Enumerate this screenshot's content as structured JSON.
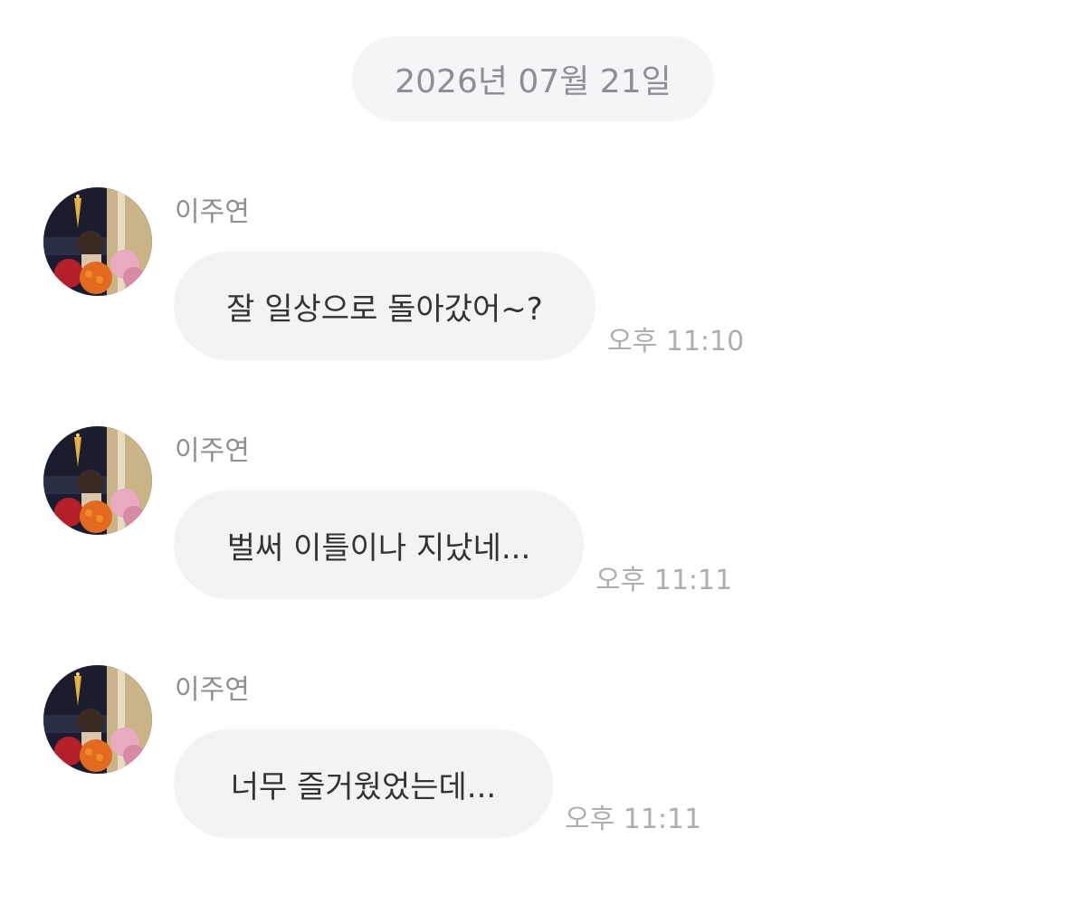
{
  "chat": {
    "date_separator": "2026년 07월 21일",
    "messages": [
      {
        "sender": "이주연",
        "text": "잘 일상으로 돌아갔어~?",
        "time": "오후 11:10"
      },
      {
        "sender": "이주연",
        "text": "벌써 이틀이나 지났네...",
        "time": "오후 11:11"
      },
      {
        "sender": "이주연",
        "text": "너무 즐거웠었는데...",
        "time": "오후 11:11"
      }
    ]
  },
  "colors": {
    "bubble_background": "#f3f3f5",
    "date_pill_background": "#f5f5f7",
    "secondary_text": "#8e8e93",
    "timestamp_text": "#aeaeb2",
    "message_text": "#333333"
  },
  "icons": {
    "avatar": "profile-photo-avatar"
  }
}
